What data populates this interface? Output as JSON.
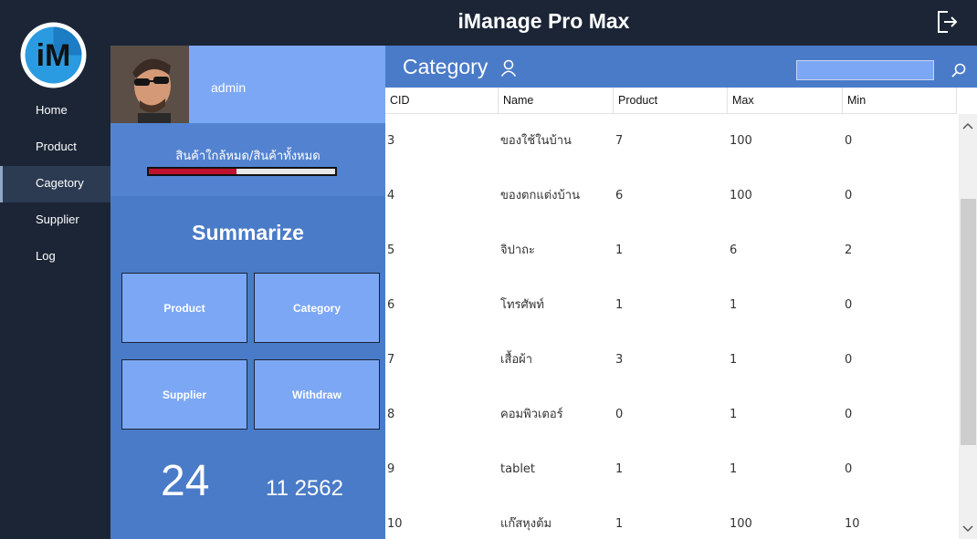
{
  "app": {
    "title": "iManage Pro Max",
    "logo_text": "iM"
  },
  "sidebar": {
    "items": [
      {
        "label": "Home",
        "active": false
      },
      {
        "label": "Product",
        "active": false
      },
      {
        "label": "Cagetory",
        "active": true
      },
      {
        "label": "Supplier",
        "active": false
      },
      {
        "label": "Log",
        "active": false
      }
    ]
  },
  "profile": {
    "username": "admin"
  },
  "stock": {
    "label": "สินค้าใกล้หมด/สินค้าทั้งหมด",
    "ratio": 0.47,
    "color": "#c0122e"
  },
  "summary": {
    "title": "Summarize",
    "tiles": [
      "Product",
      "Category",
      "Supplier",
      "Withdraw"
    ]
  },
  "date": {
    "day": "24",
    "month_year": "11 2562"
  },
  "main": {
    "title": "Category",
    "search": {
      "value": "",
      "placeholder": ""
    },
    "columns": [
      "CID",
      "Name",
      "Product",
      "Max",
      "Min"
    ],
    "rows": [
      [
        "3",
        "ของใช้ในบ้าน",
        "7",
        "100",
        "0"
      ],
      [
        "4",
        "ของตกแต่งบ้าน",
        "6",
        "100",
        "0"
      ],
      [
        "5",
        "จิปาถะ",
        "1",
        "6",
        "2"
      ],
      [
        "6",
        "โทรศัพท์",
        "1",
        "1",
        "0"
      ],
      [
        "7",
        "เสื้อผ้า",
        "3",
        "1",
        "0"
      ],
      [
        "8",
        "คอมพิวเตอร์",
        "0",
        "1",
        "0"
      ],
      [
        "9",
        "tablet",
        "1",
        "1",
        "0"
      ],
      [
        "10",
        "แก๊สหุงต้ม",
        "1",
        "100",
        "10"
      ]
    ]
  },
  "colors": {
    "sidebar": "#1b2536",
    "panel": "#4a7bc8",
    "accent": "#7ca7f4"
  }
}
